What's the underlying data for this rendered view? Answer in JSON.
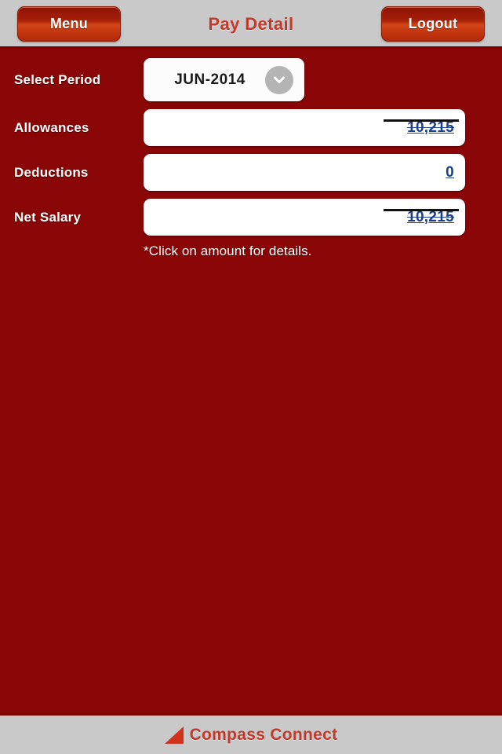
{
  "header": {
    "menu_label": "Menu",
    "title": "Pay Detail",
    "logout_label": "Logout"
  },
  "form": {
    "period": {
      "label": "Select Period",
      "selected": "JUN-2014",
      "chevron_icon": "chevron-down-icon"
    },
    "rows": [
      {
        "label": "Allowances",
        "value": "10,215",
        "struck": true
      },
      {
        "label": "Deductions",
        "value": "0",
        "struck": false
      },
      {
        "label": "Net Salary",
        "value": "10,215",
        "struck": true
      }
    ],
    "hint": "*Click on amount for details."
  },
  "footer": {
    "logo_icon": "triangle-logo-icon",
    "brand": "Compass Connect"
  },
  "colors": {
    "body_red": "#8a0606",
    "chrome_gray": "#c9c9c9",
    "title_red": "#c0392b",
    "button_red": "#b22a0a",
    "link_blue": "#1b3f8f"
  }
}
